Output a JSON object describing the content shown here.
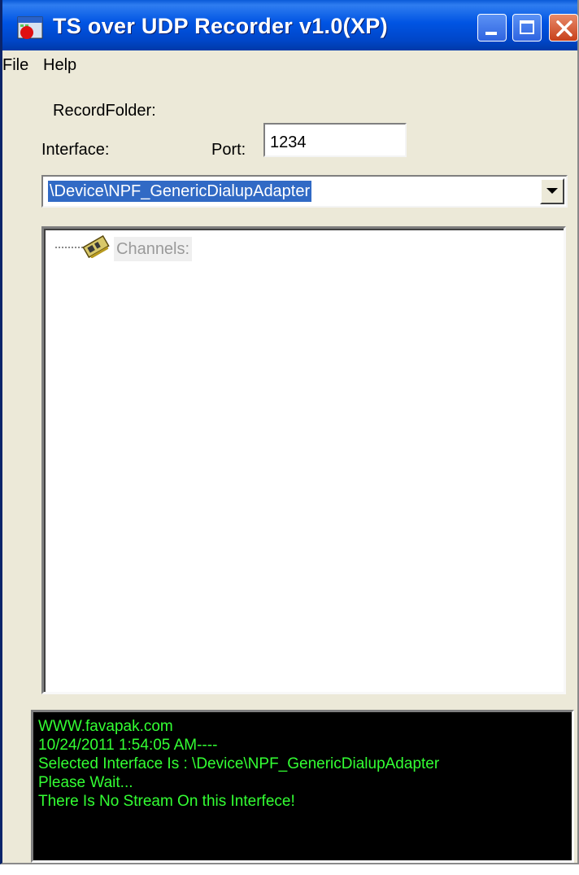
{
  "window": {
    "title": "TS over UDP Recorder v1.0(XP)"
  },
  "menu": {
    "file": "File",
    "help": "Help"
  },
  "form": {
    "record_folder_label": "RecordFolder:",
    "interface_label": "Interface:",
    "port_label": "Port:",
    "port_value": "1234",
    "interface_selected": "\\Device\\NPF_GenericDialupAdapter"
  },
  "tree": {
    "root_label": "Channels:"
  },
  "log": {
    "lines": [
      "WWW.favapak.com",
      "10/24/2011 1:54:05 AM----",
      "Selected Interface Is : \\Device\\NPF_GenericDialupAdapter",
      "Please Wait...",
      "There Is No Stream On this Interfece!"
    ],
    "text_color": "#33ff33",
    "background": "#000000"
  },
  "colors": {
    "titlebar": "#0054e3",
    "window_bg": "#ece9d8",
    "selection": "#316ac5"
  }
}
